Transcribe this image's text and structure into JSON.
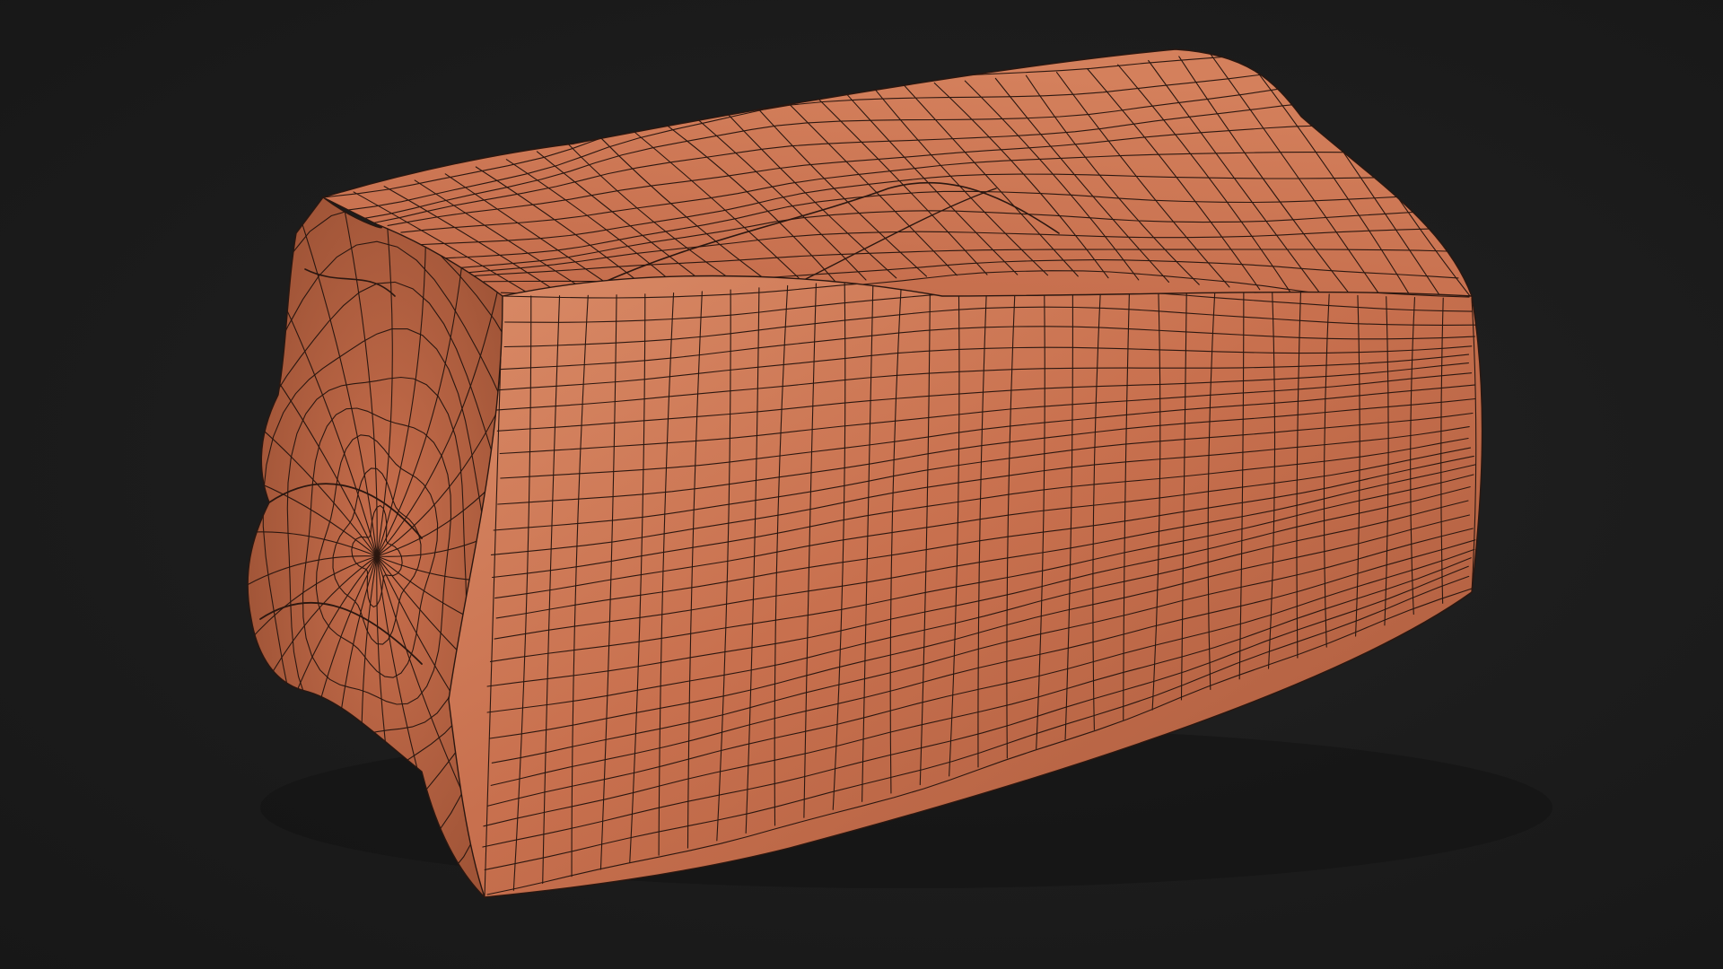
{
  "scene": {
    "background_color": "#1b1b1b",
    "object": {
      "kind": "crumpled plastic canister",
      "render_style": "clay shaded with wireframe overlay",
      "surface_color": "#c8704e",
      "shadow_color": "#9a5034",
      "highlight_color": "#d98a66",
      "wire_color": "#2b1710"
    }
  }
}
